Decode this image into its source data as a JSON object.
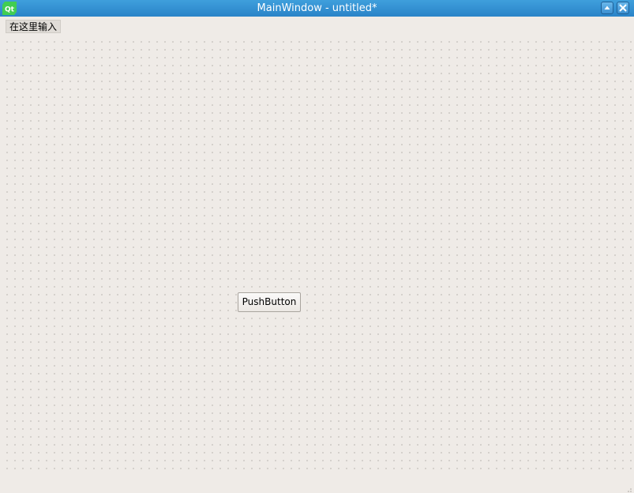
{
  "window": {
    "title": "MainWindow - untitled*",
    "accent_color": "#2a83c8",
    "background_color": "#efebe7"
  },
  "titlebar": {
    "app_icon": "qt-logo-icon",
    "buttons": [
      {
        "name": "maximize",
        "icon": "triangle-up-icon"
      },
      {
        "name": "close",
        "icon": "close-x-icon"
      }
    ]
  },
  "menubar": {
    "placeholder_item": "在这里输入"
  },
  "form": {
    "grid": "dotted",
    "widgets": [
      {
        "type": "QPushButton",
        "label": "PushButton"
      }
    ]
  },
  "statusbar": {
    "size_grip_icon": "size-grip-icon"
  }
}
